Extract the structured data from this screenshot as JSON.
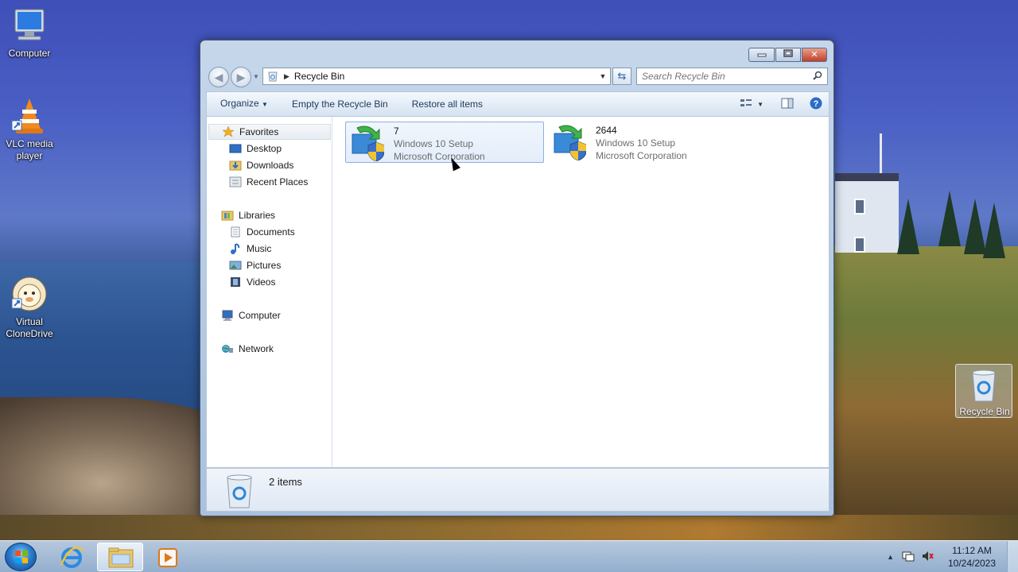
{
  "desktop": {
    "icons": [
      {
        "label": "Computer",
        "icon": "computer-icon"
      },
      {
        "label": "VLC media player",
        "icon": "vlc-icon"
      },
      {
        "label": "Virtual CloneDrive",
        "icon": "clonedrive-icon"
      },
      {
        "label": "Recycle Bin",
        "icon": "recycle-bin-icon"
      }
    ]
  },
  "window": {
    "title": "Recycle Bin",
    "controls": {
      "minimize": "▭",
      "maximize": "□",
      "close": "✕"
    },
    "address": {
      "path": "Recycle Bin"
    },
    "search": {
      "placeholder": "Search Recycle Bin"
    },
    "toolbar": {
      "organize": "Organize",
      "empty": "Empty the Recycle Bin",
      "restore": "Restore all items"
    },
    "nav": {
      "favorites": "Favorites",
      "desktop": "Desktop",
      "downloads": "Downloads",
      "recent": "Recent Places",
      "libraries": "Libraries",
      "documents": "Documents",
      "music": "Music",
      "pictures": "Pictures",
      "videos": "Videos",
      "computer": "Computer",
      "network": "Network"
    },
    "items": [
      {
        "name": "7",
        "desc": "Windows 10 Setup",
        "company": "Microsoft Corporation",
        "selected": true
      },
      {
        "name": "2644",
        "desc": "Windows 10 Setup",
        "company": "Microsoft Corporation",
        "selected": false
      }
    ],
    "details": {
      "count": "2 items"
    }
  },
  "taskbar": {
    "time": "11:12 AM",
    "date": "10/24/2023",
    "apps": [
      "internet-explorer-icon",
      "windows-explorer-icon",
      "media-player-icon"
    ]
  },
  "colors": {
    "accent": "#1e395b",
    "selection": "#8eaee0"
  }
}
